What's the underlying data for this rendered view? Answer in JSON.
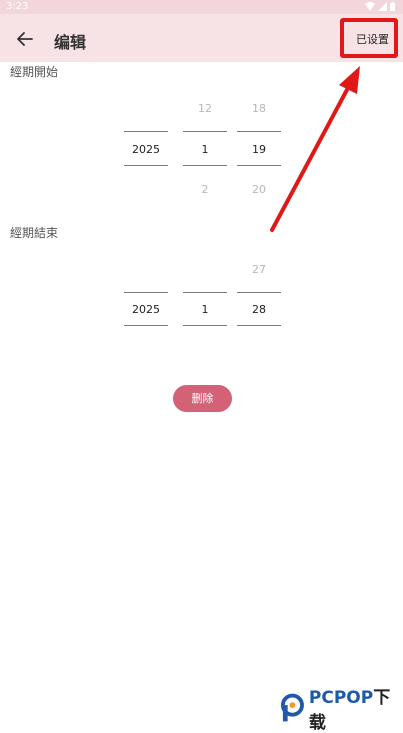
{
  "status": {
    "time": "3:23"
  },
  "header": {
    "title": "编辑",
    "action_label": "已设置"
  },
  "start": {
    "label": "經期開始",
    "year": {
      "selected": "2025"
    },
    "month": {
      "above": "12",
      "selected": "1",
      "below": "2"
    },
    "day": {
      "above": "18",
      "selected": "19",
      "below": "20"
    }
  },
  "end": {
    "label": "經期結束",
    "year": {
      "selected": "2025"
    },
    "month": {
      "selected": "1"
    },
    "day": {
      "above": "27",
      "selected": "28"
    }
  },
  "delete_label": "删除",
  "watermark": {
    "text_a": "PCPOP",
    "text_b": "下载"
  },
  "colors": {
    "appbar": "#f7e2e6",
    "accent": "#d36277",
    "annotation": "#e01818"
  }
}
